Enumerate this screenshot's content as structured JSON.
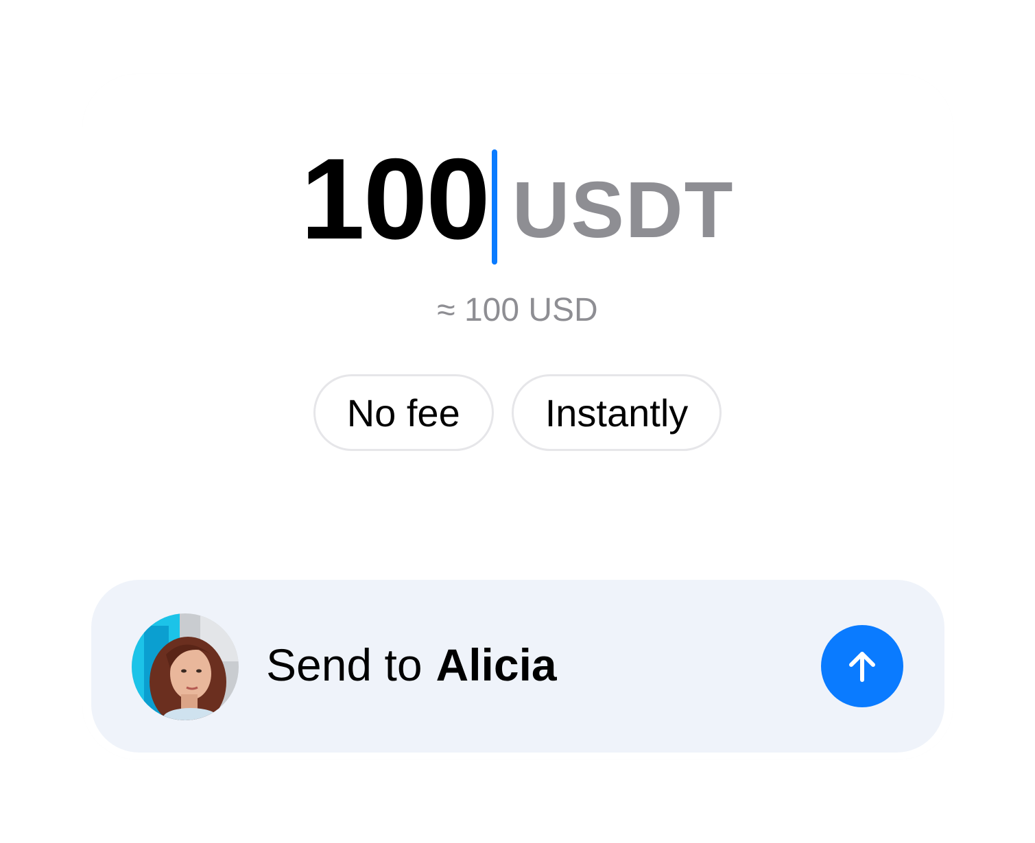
{
  "amount": {
    "value": "100",
    "currency": "USDT",
    "fiat_estimate": "≈ 100 USD"
  },
  "chips": [
    {
      "label": "No fee"
    },
    {
      "label": "Instantly"
    }
  ],
  "recipient": {
    "prefix": "Send to",
    "name": "Alicia"
  },
  "colors": {
    "accent": "#0a7bff",
    "muted_text": "#8e8e93",
    "send_bar_bg": "#eff3fa",
    "chip_border": "#e6e6e9"
  },
  "icons": {
    "send_button": "arrow-up-icon",
    "avatar": "user-avatar-photo"
  }
}
